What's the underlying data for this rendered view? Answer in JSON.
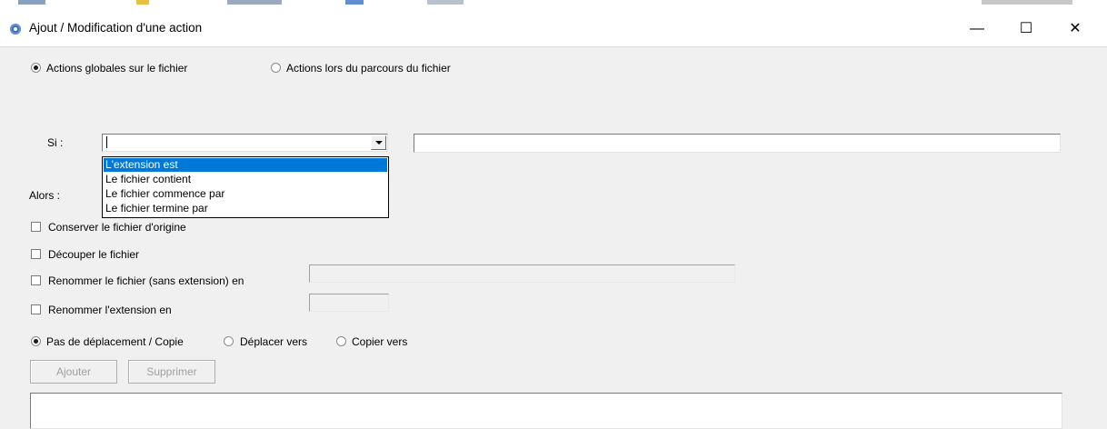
{
  "window": {
    "title": "Ajout / Modification d'une action",
    "minimize_glyph": "—",
    "maximize_glyph": "☐",
    "close_glyph": "✕"
  },
  "scope": {
    "options": [
      {
        "label": "Actions globales sur le fichier",
        "selected": true
      },
      {
        "label": "Actions lors du parcours du fichier",
        "selected": false
      }
    ]
  },
  "condition": {
    "label": "Si :",
    "combo_value": "",
    "text_value": "",
    "dropdown_options": [
      {
        "label": "L'extension est",
        "highlighted": true
      },
      {
        "label": "Le fichier contient",
        "highlighted": false
      },
      {
        "label": "Le fichier commence par",
        "highlighted": false
      },
      {
        "label": "Le fichier termine par",
        "highlighted": false
      }
    ]
  },
  "actions": {
    "label": "Alors :",
    "keep_original": {
      "label": "Conserver le fichier d'origine",
      "checked": false
    },
    "split_file": {
      "label": "Découper le fichier",
      "checked": false
    },
    "rename_file": {
      "label": "Renommer le fichier (sans extension) en",
      "checked": false,
      "value": ""
    },
    "rename_extension": {
      "label": "Renommer l'extension en",
      "checked": false,
      "value": ""
    }
  },
  "move": {
    "options": [
      {
        "label": "Pas de déplacement / Copie",
        "selected": true
      },
      {
        "label": "Déplacer vers",
        "selected": false
      },
      {
        "label": "Copier vers",
        "selected": false
      }
    ]
  },
  "buttons": {
    "add": "Ajouter",
    "remove": "Supprimer"
  },
  "colors": {
    "selection": "#0078d7",
    "window_bg": "#f0f0f0",
    "disabled_text": "#a0a0a0"
  }
}
